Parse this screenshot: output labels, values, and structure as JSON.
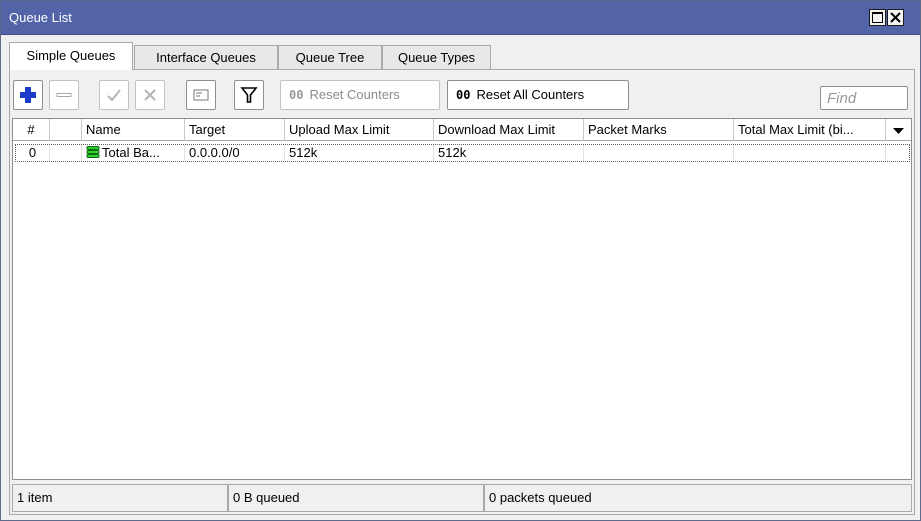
{
  "window": {
    "title": "Queue List"
  },
  "tabs": [
    {
      "label": "Simple Queues",
      "active": true
    },
    {
      "label": "Interface Queues",
      "active": false
    },
    {
      "label": "Queue Tree",
      "active": false
    },
    {
      "label": "Queue Types",
      "active": false
    }
  ],
  "toolbar": {
    "add_icon": "plus-icon",
    "remove_icon": "minus-icon",
    "enable_icon": "check-icon",
    "disable_icon": "x-icon",
    "comment_icon": "comment-icon",
    "filter_icon": "filter-icon",
    "reset_counters_label": "Reset Counters",
    "reset_counters_glyph": "00",
    "reset_all_counters_label": "Reset All Counters",
    "reset_all_counters_glyph": "00",
    "find_placeholder": "Find",
    "accent_color": "#1a3cc8"
  },
  "table": {
    "columns": [
      "#",
      "",
      "Name",
      "Target",
      "Upload Max Limit",
      "Download Max Limit",
      "Packet Marks",
      "Total Max Limit (bi..."
    ],
    "rows": [
      {
        "num": "0",
        "flag": "",
        "icon": "simple-queue-icon",
        "name": "Total Ba...",
        "target": "0.0.0.0/0",
        "upload_max_limit": "512k",
        "download_max_limit": "512k",
        "packet_marks": "",
        "total_max_limit": ""
      }
    ]
  },
  "status": {
    "items": "1 item",
    "queued_bytes": "0 B queued",
    "queued_packets": "0 packets queued"
  }
}
